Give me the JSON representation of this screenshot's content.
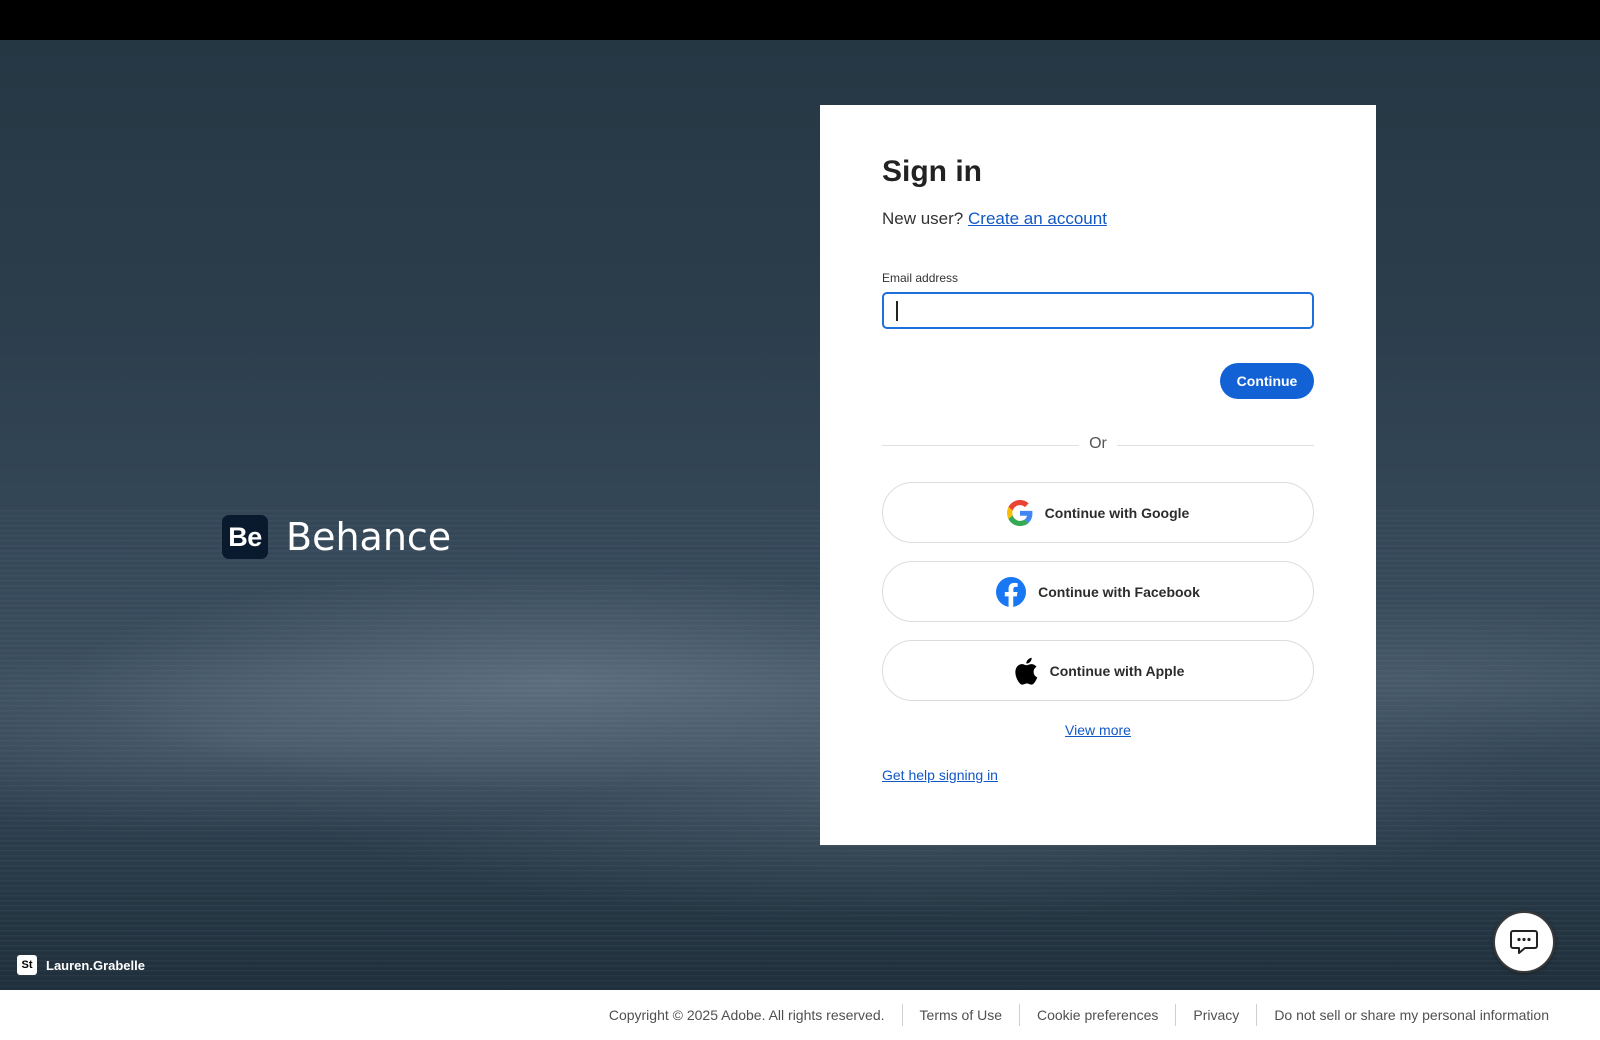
{
  "brand": {
    "logo_text": "Be",
    "name": "Behance"
  },
  "photo_credit": {
    "icon_text": "St",
    "name": "Lauren.Grabelle"
  },
  "signin": {
    "title": "Sign in",
    "new_user_text": "New user?",
    "create_account_link": "Create an account",
    "email_label": "Email address",
    "email_value": "",
    "continue_label": "Continue",
    "divider_text": "Or",
    "google_label": "Continue with Google",
    "facebook_label": "Continue with Facebook",
    "apple_label": "Continue with Apple",
    "view_more": "View more",
    "help_link": "Get help signing in"
  },
  "footer": {
    "copyright": "Copyright © 2025 Adobe. All rights reserved.",
    "terms": "Terms of Use",
    "cookies": "Cookie preferences",
    "privacy": "Privacy",
    "do_not_sell": "Do not sell or share my personal information"
  },
  "colors": {
    "accent": "#1262d6",
    "link": "#1258c4",
    "facebook": "#1877f2",
    "google_blue": "#4285f4",
    "google_red": "#ea4335",
    "google_yellow": "#fbbc05",
    "google_green": "#34a853"
  },
  "icons": {
    "google": "google-icon",
    "facebook": "facebook-icon",
    "apple": "apple-icon",
    "chat": "chat-bubble-icon"
  }
}
